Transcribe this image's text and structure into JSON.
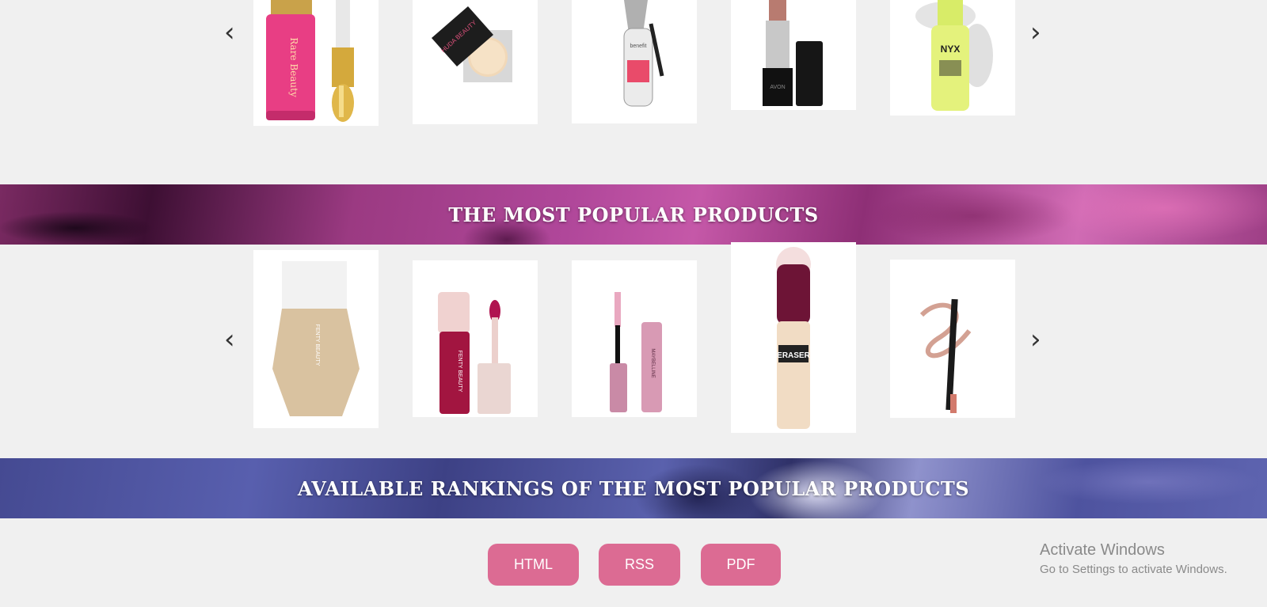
{
  "carousel_top": {
    "prev_arrow": "‹",
    "next_arrow": "›",
    "products": [
      {
        "name": "rare-beauty-liquid-blush",
        "brand_text": "Rare Beauty"
      },
      {
        "name": "huda-beauty-setting-powder",
        "brand_text": "HUDA BEAUTY"
      },
      {
        "name": "benefit-brow-gel",
        "brand_text": "benefit"
      },
      {
        "name": "avon-lipstick",
        "brand_text": "AVON"
      },
      {
        "name": "nyx-plump-right-back-primer",
        "brand_text": "NYX"
      }
    ]
  },
  "banner_popular": {
    "title": "THE MOST POPULAR PRODUCTS"
  },
  "carousel_popular": {
    "prev_arrow": "‹",
    "next_arrow": "›",
    "products": [
      {
        "name": "fenty-beauty-foundation",
        "brand_text": "FENTY BEAUTY"
      },
      {
        "name": "fenty-beauty-lip-gloss",
        "brand_text": "FENTY BEAUTY"
      },
      {
        "name": "maybelline-mascara",
        "brand_text": "MAYBELLINE"
      },
      {
        "name": "maybelline-eraser-concealer",
        "brand_text": "ERASER"
      },
      {
        "name": "lip-liner-pencil",
        "brand_text": ""
      }
    ]
  },
  "banner_rankings": {
    "title": "AVAILABLE RANKINGS OF THE MOST POPULAR PRODUCTS"
  },
  "formats": {
    "html_label": "HTML",
    "rss_label": "RSS",
    "pdf_label": "PDF"
  },
  "watermark": {
    "title": "Activate Windows",
    "subtitle": "Go to Settings to activate Windows."
  },
  "colors": {
    "button": "#dc6b93",
    "banner_pink": "#b0479a",
    "banner_blue": "#585fae",
    "page_background": "#f0f0f0"
  }
}
